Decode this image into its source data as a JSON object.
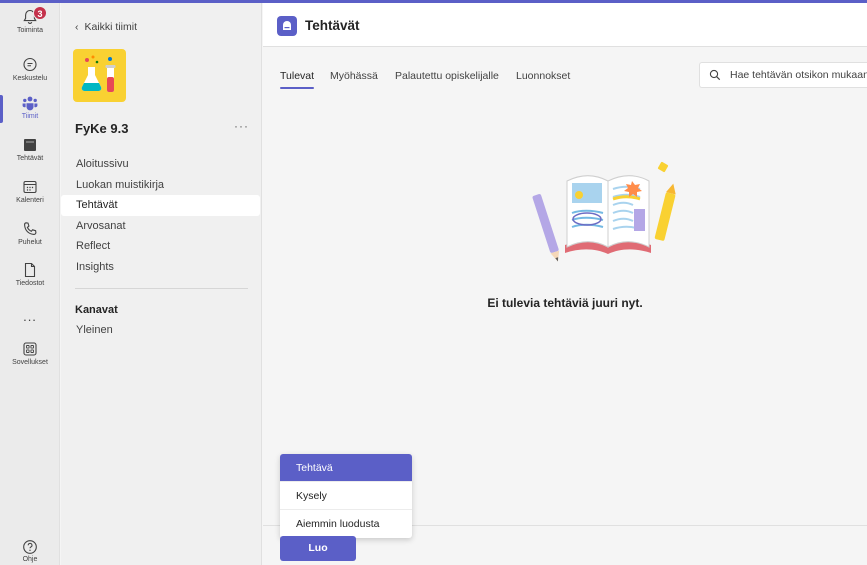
{
  "rail": {
    "items": [
      {
        "label": "Toiminta",
        "icon": "bell-icon",
        "badge": "3"
      },
      {
        "label": "Keskustelu",
        "icon": "chat-icon"
      },
      {
        "label": "Tiimit",
        "icon": "teams-icon"
      },
      {
        "label": "Tehtävät",
        "icon": "assignments-icon"
      },
      {
        "label": "Kalenteri",
        "icon": "calendar-icon"
      },
      {
        "label": "Puhelut",
        "icon": "phone-icon"
      },
      {
        "label": "Tiedostot",
        "icon": "file-icon"
      },
      {
        "label": "...",
        "icon": "more-icon"
      },
      {
        "label": "Sovellukset",
        "icon": "apps-icon"
      }
    ],
    "help": {
      "label": "Ohje",
      "icon": "help-icon"
    },
    "accent": "#5b5fc7"
  },
  "pane": {
    "back_label": "Kaikki tiimit",
    "team_name": "FyKe 9.3",
    "more": "···",
    "nav": [
      "Aloitussivu",
      "Luokan muistikirja",
      "Tehtävät",
      "Arvosanat",
      "Reflect",
      "Insights"
    ],
    "section": "Kanavat",
    "channels": [
      "Yleinen"
    ]
  },
  "main": {
    "title": "Tehtävät",
    "tabs": [
      "Tulevat",
      "Myöhässä",
      "Palautettu opiskelijalle",
      "Luonnokset"
    ],
    "search_placeholder": "Hae tehtävän otsikon mukaan",
    "empty_message": "Ei tulevia tehtäviä juuri nyt.",
    "menu": [
      "Tehtävä",
      "Kysely",
      "Aiemmin luodusta"
    ],
    "create_label": "Luo"
  }
}
